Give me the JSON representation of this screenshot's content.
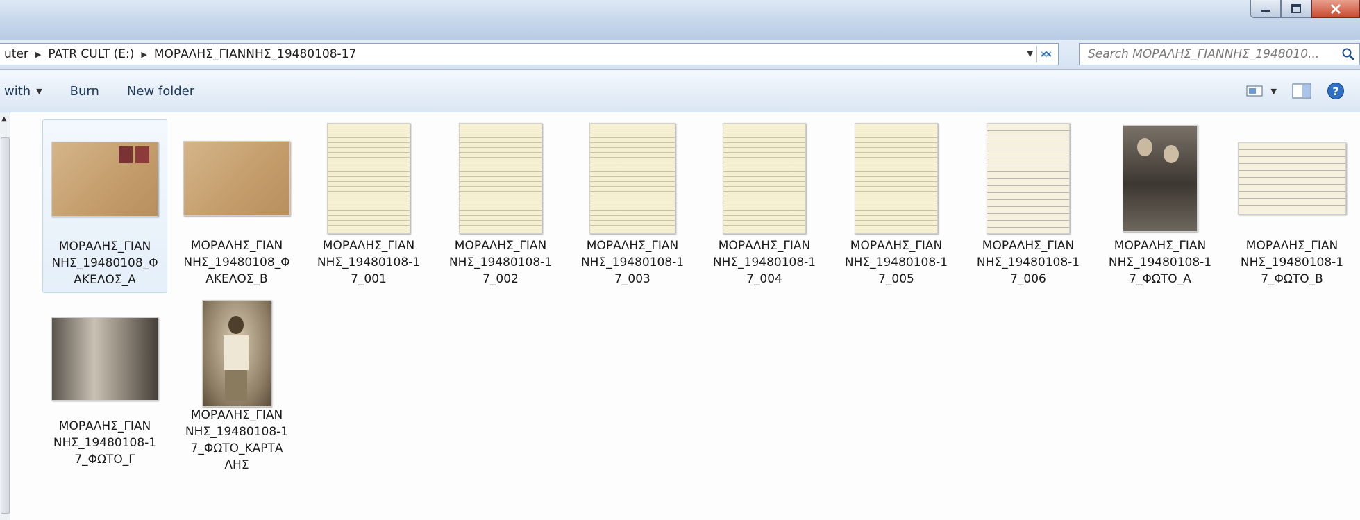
{
  "window": {
    "title_icons": [
      "minimize-icon",
      "maximize-icon",
      "close-icon"
    ]
  },
  "address": {
    "crumbs": [
      "uter",
      "PATR CULT (E:)",
      "ΜΟΡΑΛΗΣ_ΓΙΑΝΝΗΣ_19480108-17"
    ]
  },
  "search": {
    "placeholder": "Search ΜΟΡΑΛΗΣ_ΓΙΑΝΝΗΣ_1948010..."
  },
  "toolbar": {
    "open_with": "with",
    "burn": "Burn",
    "new_folder": "New folder"
  },
  "files": [
    {
      "name": "ΜΟΡΑΛΗΣ_ΓΙΑΝΝΗΣ_19480108_ΦΑΚΕΛΟΣ_Α",
      "label": "ΜΟΡΑΛΗΣ_ΓΙΑΝ\nΝΗΣ_19480108_Φ\nΑΚΕΛΟΣ_Α",
      "kind": "envelope",
      "selected": true
    },
    {
      "name": "ΜΟΡΑΛΗΣ_ΓΙΑΝΝΗΣ_19480108_ΦΑΚΕΛΟΣ_Β",
      "label": "ΜΟΡΑΛΗΣ_ΓΙΑΝ\nΝΗΣ_19480108_Φ\nΑΚΕΛΟΣ_Β",
      "kind": "envelope"
    },
    {
      "name": "ΜΟΡΑΛΗΣ_ΓΙΑΝΝΗΣ_19480108-17_001",
      "label": "ΜΟΡΑΛΗΣ_ΓΙΑΝ\nΝΗΣ_19480108-1\n7_001",
      "kind": "letter"
    },
    {
      "name": "ΜΟΡΑΛΗΣ_ΓΙΑΝΝΗΣ_19480108-17_002",
      "label": "ΜΟΡΑΛΗΣ_ΓΙΑΝ\nΝΗΣ_19480108-1\n7_002",
      "kind": "letter"
    },
    {
      "name": "ΜΟΡΑΛΗΣ_ΓΙΑΝΝΗΣ_19480108-17_003",
      "label": "ΜΟΡΑΛΗΣ_ΓΙΑΝ\nΝΗΣ_19480108-1\n7_003",
      "kind": "letter"
    },
    {
      "name": "ΜΟΡΑΛΗΣ_ΓΙΑΝΝΗΣ_19480108-17_004",
      "label": "ΜΟΡΑΛΗΣ_ΓΙΑΝ\nΝΗΣ_19480108-1\n7_004",
      "kind": "letter"
    },
    {
      "name": "ΜΟΡΑΛΗΣ_ΓΙΑΝΝΗΣ_19480108-17_005",
      "label": "ΜΟΡΑΛΗΣ_ΓΙΑΝ\nΝΗΣ_19480108-1\n7_005",
      "kind": "letter"
    },
    {
      "name": "ΜΟΡΑΛΗΣ_ΓΙΑΝΝΗΣ_19480108-17_006",
      "label": "ΜΟΡΑΛΗΣ_ΓΙΑΝ\nΝΗΣ_19480108-1\n7_006",
      "kind": "letter"
    },
    {
      "name": "ΜΟΡΑΛΗΣ_ΓΙΑΝΝΗΣ_19480108-17_ΦΩΤΟ_Α",
      "label": "ΜΟΡΑΛΗΣ_ΓΙΑΝ\nΝΗΣ_19480108-1\n7_ΦΩΤΟ_Α",
      "kind": "photo-couple"
    },
    {
      "name": "ΜΟΡΑΛΗΣ_ΓΙΑΝΝΗΣ_19480108-17_ΦΩΤΟ_Β",
      "label": "ΜΟΡΑΛΗΣ_ΓΙΑΝ\nΝΗΣ_19480108-1\n7_ΦΩΤΟ_Β",
      "kind": "letter-wide"
    },
    {
      "name": "ΜΟΡΑΛΗΣ_ΓΙΑΝΝΗΣ_19480108-17_ΦΩΤΟ_Γ",
      "label": "ΜΟΡΑΛΗΣ_ΓΙΑΝ\nΝΗΣ_19480108-1\n7_ΦΩΤΟ_Γ",
      "kind": "photo-room"
    },
    {
      "name": "ΜΟΡΑΛΗΣ_ΓΙΑΝΝΗΣ_19480108-17_ΦΩΤΟ_ΚΑΡΤΑΛΗΣ",
      "label": "ΜΟΡΑΛΗΣ_ΓΙΑΝ\nΝΗΣ_19480108-1\n7_ΦΩΤΟ_ΚΑΡΤΑ\nΛΗΣ",
      "kind": "photo-man"
    }
  ]
}
